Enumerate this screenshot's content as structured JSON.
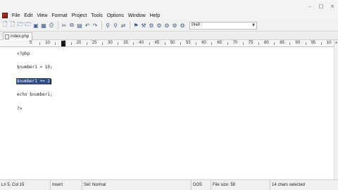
{
  "menu": {
    "items": [
      "File",
      "Edit",
      "View",
      "Format",
      "Project",
      "Tools",
      "Options",
      "Window",
      "Help"
    ]
  },
  "window_controls": [
    "minimize-icon",
    "restore-icon",
    "close-icon"
  ],
  "toolbar": {
    "icons": [
      "new-file-icon",
      "new-file-icon",
      "open-folder-icon",
      "open-folder-icon",
      "save-icon",
      "save-all-icon",
      "print-icon",
      "cut-icon",
      "copy-icon",
      "paste-icon",
      "undo-icon",
      "redo-icon",
      "find-icon",
      "find-in-files-icon",
      "replace-icon",
      "bookmark-icon",
      "tool-icon",
      "user-tool-icon",
      "user-tool-icon",
      "user-tool-icon",
      "user-tool-icon",
      "user-tool-icon"
    ],
    "syntax_value": "PHP"
  },
  "tab": {
    "label": "index.php"
  },
  "ruler": {
    "labels": [
      "5",
      "10",
      "15",
      "20",
      "25",
      "30",
      "35",
      "40",
      "45",
      "50",
      "55",
      "60",
      "65",
      "70",
      "75",
      "80",
      "85",
      "90",
      "95",
      "10"
    ]
  },
  "editor": {
    "lines": [
      {
        "text": "<?php",
        "selected": false
      },
      {
        "text": "$number1 = 10;",
        "selected": false
      },
      {
        "text": "$number1 += 2;",
        "selected": true
      },
      {
        "text": "echo $number1;",
        "selected": false
      },
      {
        "text": "?>",
        "selected": false
      }
    ],
    "selection_color": "#2f4d84"
  },
  "status": {
    "position": "Ln 5, Col 15",
    "mode": "Insert",
    "syntax": "Sel: Normal",
    "line_endings": "DOS",
    "file_size": "File size: 58",
    "selection": "14 chars selected"
  }
}
